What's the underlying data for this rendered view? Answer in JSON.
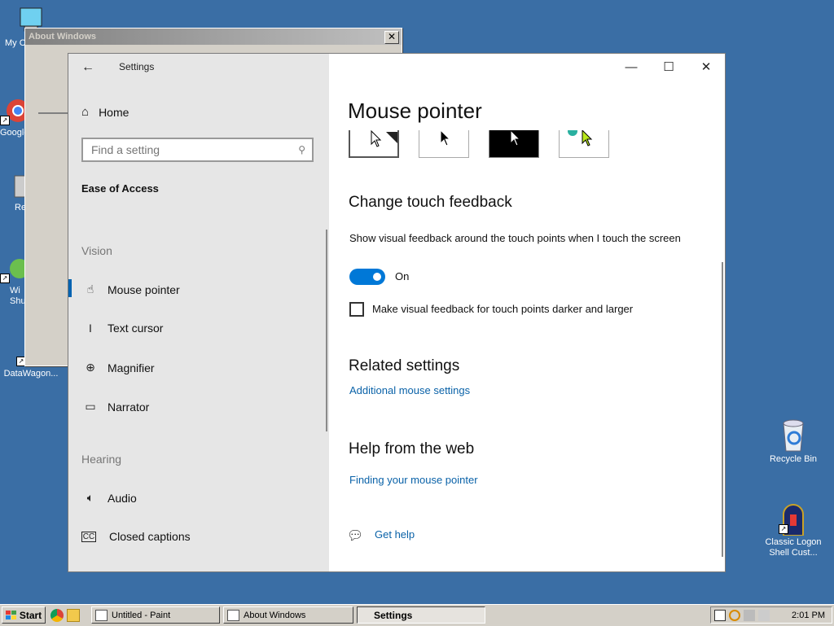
{
  "desktop": {
    "icons": [
      {
        "label": "My C",
        "name": "my-computer"
      },
      {
        "label": "Google",
        "name": "google-chrome"
      },
      {
        "label": "Re",
        "name": "recycle-partial"
      },
      {
        "label": "Wi Shu",
        "name": "windows-shortcut"
      },
      {
        "label": "DataWagon...",
        "name": "datawagon"
      },
      {
        "label": "Recycle Bin",
        "name": "recycle-bin"
      },
      {
        "label": "Classic Logon Shell Cust...",
        "name": "classic-logon"
      }
    ]
  },
  "about_window": {
    "title": "About Windows",
    "close": "✕"
  },
  "settings": {
    "title": "Settings",
    "back": "←",
    "home": "Home",
    "search_placeholder": "Find a setting",
    "section": "Ease of Access",
    "categories": {
      "vision": "Vision",
      "hearing": "Hearing"
    },
    "nav": {
      "mouse_pointer": "Mouse pointer",
      "text_cursor": "Text cursor",
      "magnifier": "Magnifier",
      "narrator": "Narrator",
      "audio": "Audio",
      "closed_captions": "Closed captions"
    },
    "window_buttons": {
      "minimize": "—",
      "maximize": "☐",
      "close": "✕"
    },
    "content": {
      "page_title": "Mouse pointer",
      "touch_heading": "Change touch feedback",
      "touch_desc": "Show visual feedback around the touch points when I touch the screen",
      "toggle_state": "On",
      "toggle_on": true,
      "checkbox_label": "Make visual feedback for touch points darker and larger",
      "checkbox_checked": false,
      "related_heading": "Related settings",
      "related_link": "Additional mouse settings",
      "web_heading": "Help from the web",
      "web_link": "Finding your mouse pointer",
      "get_help": "Get help"
    },
    "accent_color": "#0078d7"
  },
  "taskbar": {
    "start": "Start",
    "tasks": [
      {
        "label": "Untitled - Paint"
      },
      {
        "label": "About Windows"
      },
      {
        "label": "Settings"
      }
    ],
    "clock": "2:01 PM"
  }
}
